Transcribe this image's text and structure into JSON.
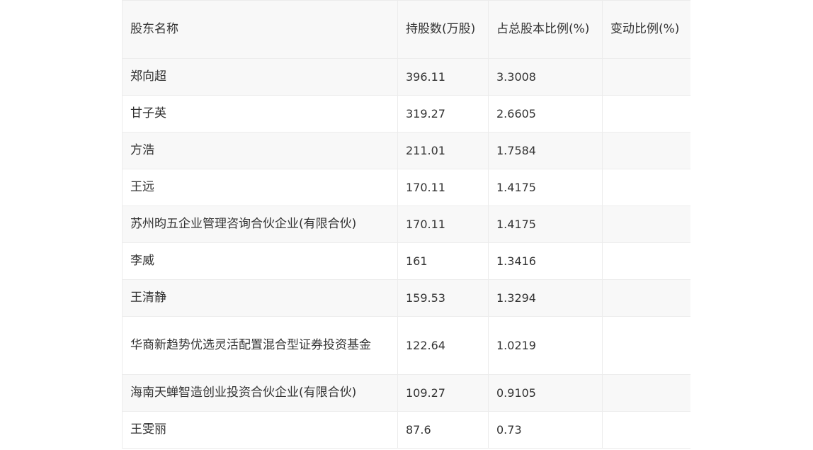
{
  "table": {
    "headers": [
      "股东名称",
      "持股数(万股)",
      "占总股本比例(%)",
      "变动比例(%)"
    ],
    "rows": [
      {
        "name": "郑向超",
        "shares": "396.11",
        "ratio": "3.3008",
        "change": ""
      },
      {
        "name": "甘子英",
        "shares": "319.27",
        "ratio": "2.6605",
        "change": ""
      },
      {
        "name": "方浩",
        "shares": "211.01",
        "ratio": "1.7584",
        "change": ""
      },
      {
        "name": "王远",
        "shares": "170.11",
        "ratio": "1.4175",
        "change": ""
      },
      {
        "name": "苏州昀五企业管理咨询合伙企业(有限合伙)",
        "shares": "170.11",
        "ratio": "1.4175",
        "change": ""
      },
      {
        "name": "李威",
        "shares": "161",
        "ratio": "1.3416",
        "change": ""
      },
      {
        "name": "王清静",
        "shares": "159.53",
        "ratio": "1.3294",
        "change": ""
      },
      {
        "name": "华商新趋势优选灵活配置混合型证券投资基金",
        "shares": "122.64",
        "ratio": "1.0219",
        "change": ""
      },
      {
        "name": "海南天蝉智造创业投资合伙企业(有限合伙)",
        "shares": "109.27",
        "ratio": "0.9105",
        "change": ""
      },
      {
        "name": "王雯丽",
        "shares": "87.6",
        "ratio": "0.73",
        "change": ""
      }
    ]
  }
}
